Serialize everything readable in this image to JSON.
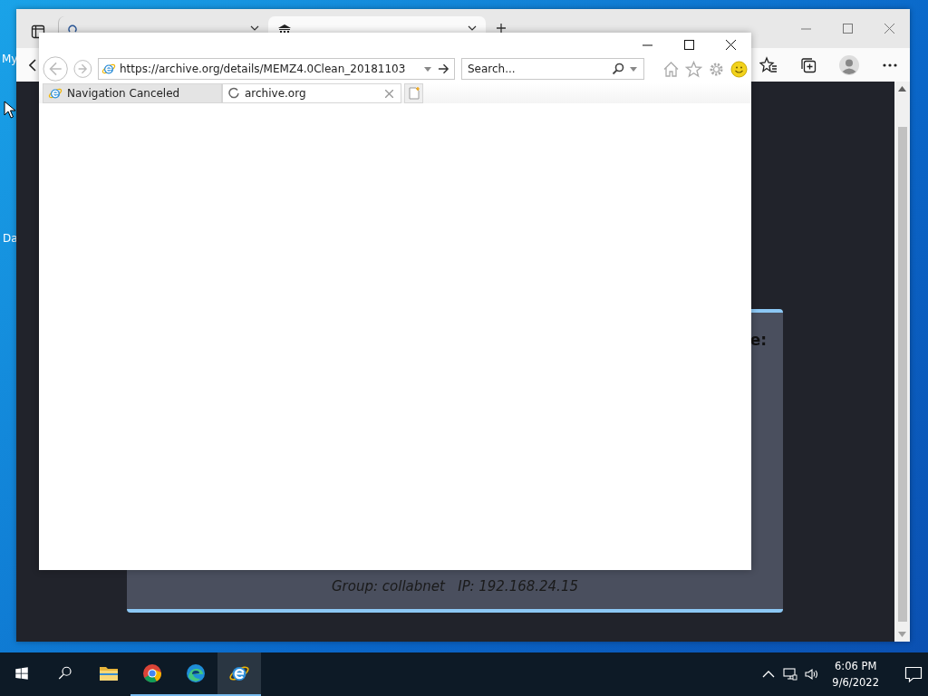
{
  "desktop": {
    "icons": [
      {
        "label": "My"
      },
      {
        "label": "Da"
      }
    ]
  },
  "edge_window": {
    "tabs": [
      {
        "kind": "search",
        "selected": false
      },
      {
        "kind": "site",
        "selected": true
      }
    ],
    "page": {
      "heading_fragment": "e:",
      "footer": "Group: collabnet   IP: 192.168.24.15"
    }
  },
  "ie_window": {
    "address": "https://archive.org/details/MEMZ4.0Clean_20181103",
    "search_placeholder": "Search...",
    "tabs": [
      {
        "title": "Navigation Canceled",
        "selected": false,
        "loading": false
      },
      {
        "title": "archive.org",
        "selected": true,
        "loading": true
      }
    ]
  },
  "taskbar": {
    "apps": [
      {
        "kind": "folder",
        "running": false,
        "active": false
      },
      {
        "kind": "chrome",
        "running": true,
        "active": false
      },
      {
        "kind": "edge",
        "running": true,
        "active": false
      },
      {
        "kind": "ie",
        "running": true,
        "active": true
      }
    ],
    "clock": {
      "time": "6:06 PM",
      "date": "9/6/2022"
    }
  }
}
